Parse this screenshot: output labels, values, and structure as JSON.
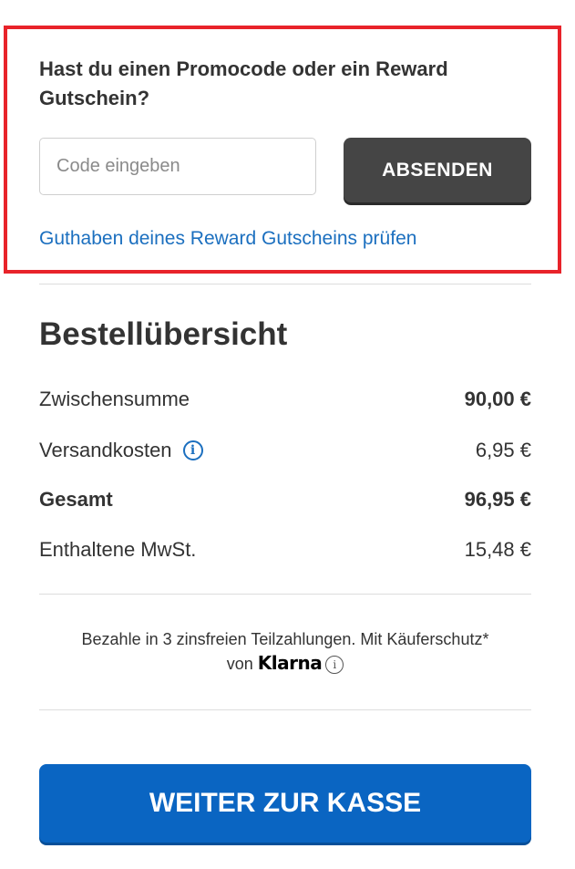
{
  "promo": {
    "title": "Hast du einen Promocode oder ein Reward Gutschein?",
    "input_placeholder": "Code eingeben",
    "input_value": "",
    "submit_label": "ABSENDEN",
    "reward_link": "Guthaben deines Reward Gutscheins prüfen",
    "highlight_color": "#e8232a"
  },
  "summary": {
    "title": "Bestellübersicht",
    "rows": [
      {
        "label": "Zwischensumme",
        "value": "90,00 €"
      },
      {
        "label": "Versandkosten",
        "value": "6,95 €",
        "icon": "info-icon"
      },
      {
        "label": "Gesamt",
        "value": "96,95 €"
      },
      {
        "label": "Enthaltene MwSt.",
        "value": "15,48 €"
      }
    ]
  },
  "klarna": {
    "text": "Bezahle in 3 zinsfreien Teilzahlungen. Mit Käuferschutz*",
    "von": "von",
    "logo": "Klarna",
    "icon": "info-icon"
  },
  "checkout": {
    "label": "WEITER ZUR KASSE",
    "color": "#0a65c2"
  }
}
